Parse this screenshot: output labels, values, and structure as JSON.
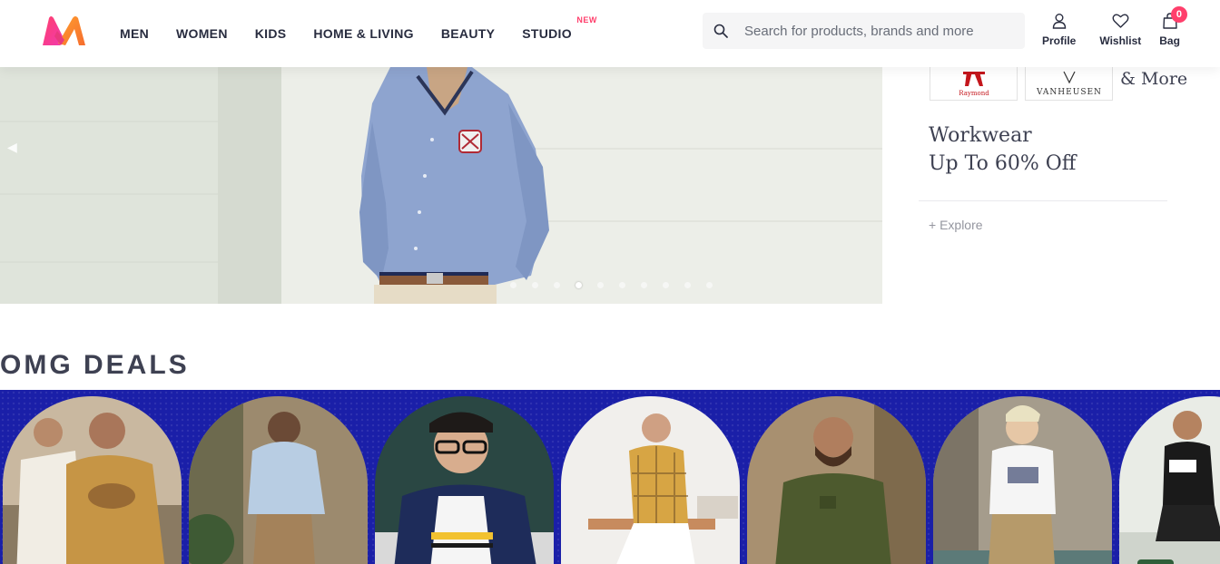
{
  "header": {
    "logo": "myntra-logo",
    "nav": [
      {
        "label": "MEN"
      },
      {
        "label": "WOMEN"
      },
      {
        "label": "KIDS"
      },
      {
        "label": "HOME & LIVING"
      },
      {
        "label": "BEAUTY"
      },
      {
        "label": "STUDIO",
        "badge": "NEW"
      }
    ],
    "search": {
      "placeholder": "Search for products, brands and more",
      "value": "",
      "icon": "search-icon"
    },
    "actions": {
      "profile": {
        "label": "Profile",
        "icon": "profile-icon"
      },
      "wishlist": {
        "label": "Wishlist",
        "icon": "heart-icon"
      },
      "bag": {
        "label": "Bag",
        "icon": "bag-icon",
        "count": "0"
      }
    }
  },
  "banner": {
    "slides_total": 10,
    "active_slide": 4,
    "brands": [
      {
        "name": "raymond",
        "logo_text": "Raymond"
      },
      {
        "name": "van-heusen",
        "logo_text": "VANHEUSEN"
      }
    ],
    "more_text": "& More",
    "title_line1": "Workwear",
    "title_line2": "Up To 60% Off",
    "cta": "+ Explore"
  },
  "deals": {
    "title": "OMG DEALS",
    "cards": 7
  },
  "colors": {
    "accent": "#ff3f6c",
    "text": "#282c3f",
    "deals_bg": "#1a1fa8"
  }
}
